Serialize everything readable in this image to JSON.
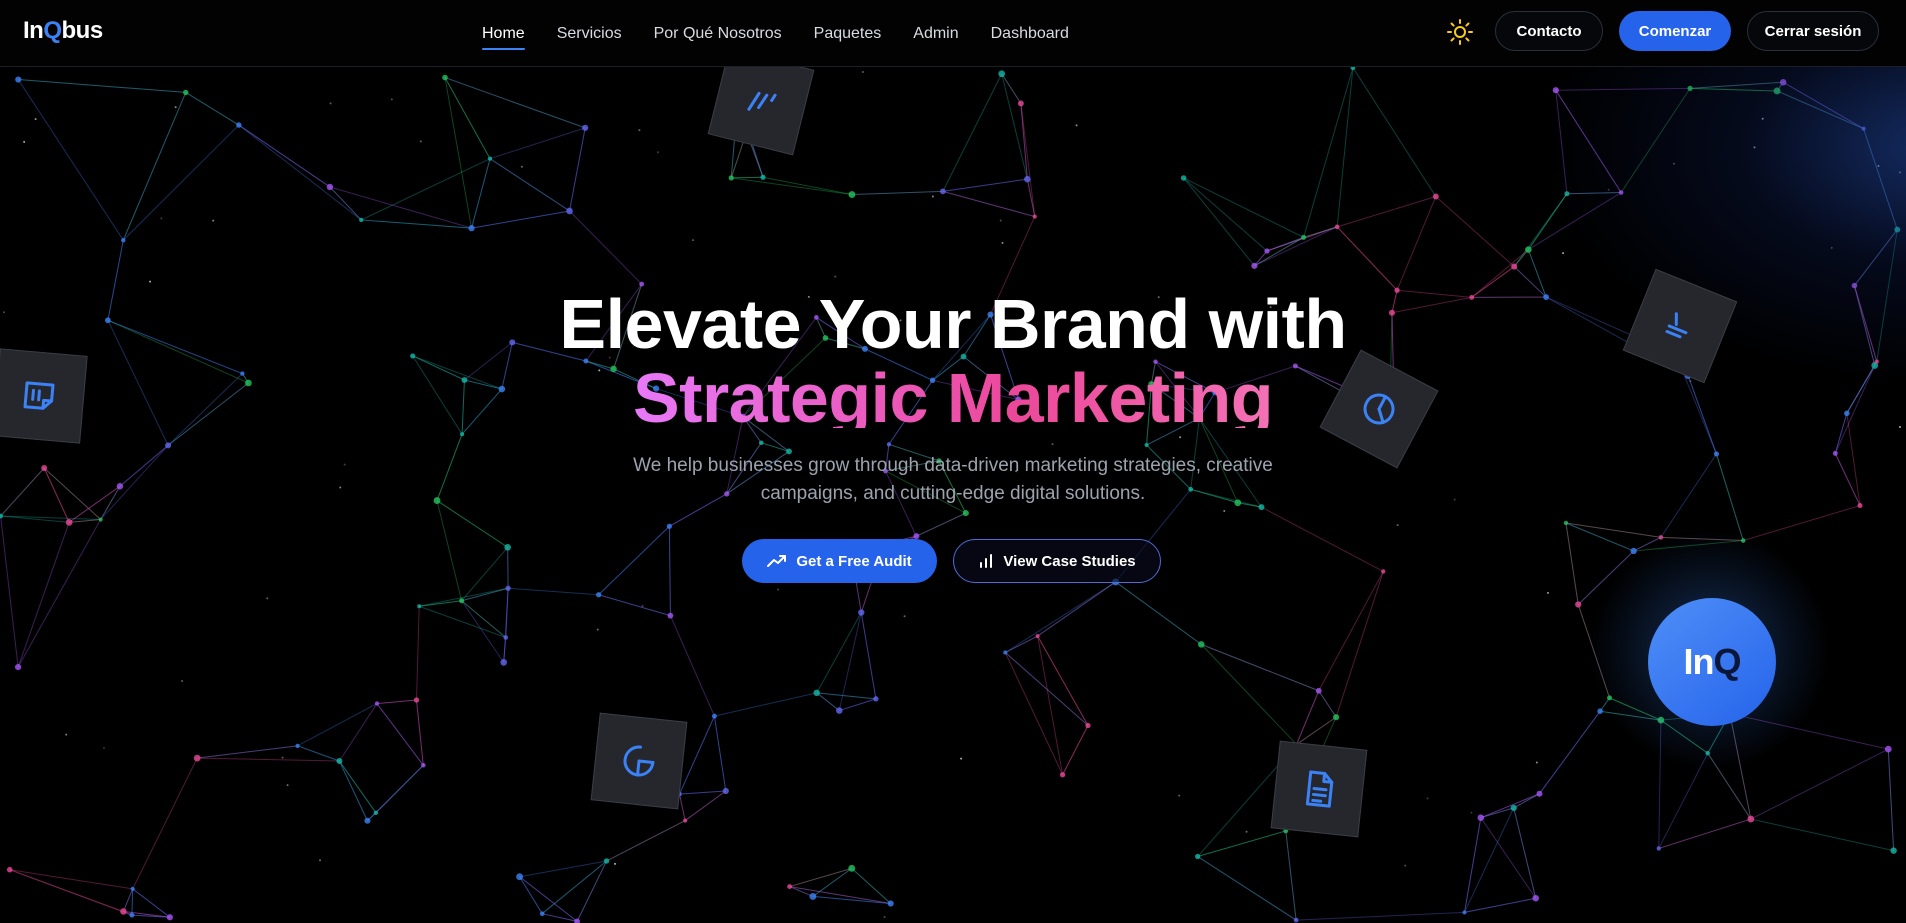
{
  "brand": {
    "logo_part1": "In",
    "logo_q": "Q",
    "logo_part2": "bus"
  },
  "nav": {
    "links": [
      {
        "label": "Home",
        "active": true
      },
      {
        "label": "Servicios"
      },
      {
        "label": "Por Qué Nosotros"
      },
      {
        "label": "Paquetes"
      },
      {
        "label": "Admin"
      },
      {
        "label": "Dashboard"
      }
    ],
    "theme_icon": "sun-icon",
    "contact_label": "Contacto",
    "start_label": "Comenzar",
    "logout_label": "Cerrar sesión"
  },
  "hero": {
    "title_line1": "Elevate Your Brand with",
    "title_line2": "Strategic Marketing",
    "subtitle": "We help businesses grow through data-driven marketing strategies, creative campaigns, and cutting-edge digital solutions.",
    "cta_primary": {
      "label": "Get a Free Audit",
      "icon": "trending-up-icon"
    },
    "cta_secondary": {
      "label": "View Case Studies",
      "icon": "bar-chart-icon"
    }
  },
  "orb": {
    "text_part1": "In",
    "text_q": "Q"
  },
  "colors": {
    "accent": "#2563eb",
    "gradient_start": "#e879f9",
    "gradient_end": "#ec4899",
    "icon_blue": "#3b82f6"
  }
}
